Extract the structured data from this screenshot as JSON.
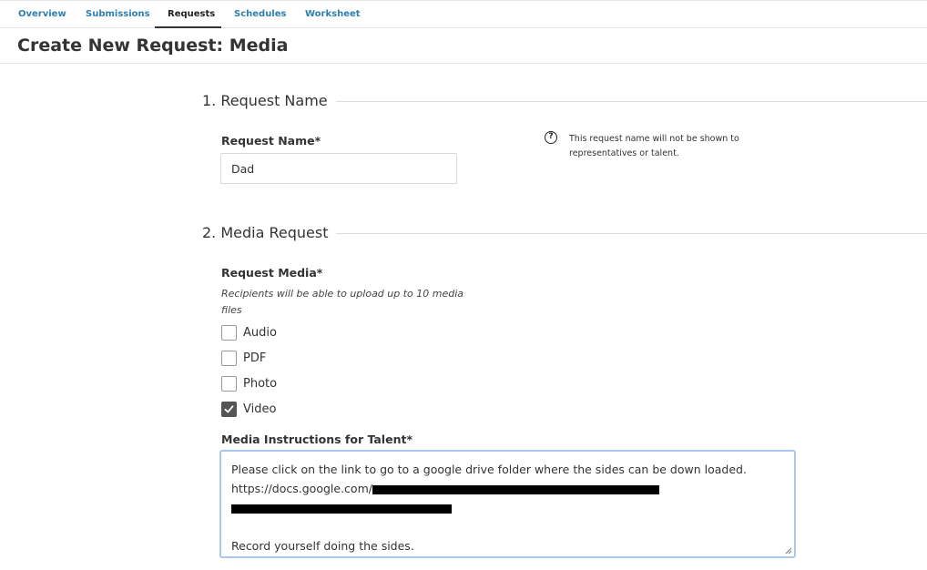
{
  "tabs": [
    {
      "label": "Overview",
      "active": false
    },
    {
      "label": "Submissions",
      "active": false
    },
    {
      "label": "Requests",
      "active": true
    },
    {
      "label": "Schedules",
      "active": false
    },
    {
      "label": "Worksheet",
      "active": false
    }
  ],
  "page_title": "Create New Request: Media",
  "section1": {
    "title": "1. Request Name",
    "field_label": "Request Name*",
    "field_value": "Dad",
    "help_text": "This request name will not be shown to representatives or talent."
  },
  "section2": {
    "title": "2. Media Request",
    "field_label": "Request Media*",
    "hint": "Recipients will be able to upload up to 10 media files",
    "options": [
      {
        "label": "Audio",
        "checked": false
      },
      {
        "label": "PDF",
        "checked": false
      },
      {
        "label": "Photo",
        "checked": false
      },
      {
        "label": "Video",
        "checked": true
      }
    ],
    "instructions_label": "Media Instructions for Talent*",
    "instructions": {
      "line1": "Please click on the link to go to a google drive folder where the sides can be down loaded.",
      "line2_prefix": "https://docs.google.com/",
      "line4": "Record yourself doing the sides."
    }
  },
  "colors": {
    "link": "#2e7fb0",
    "focus_border": "#a9c8ee",
    "checked": "#555555"
  }
}
